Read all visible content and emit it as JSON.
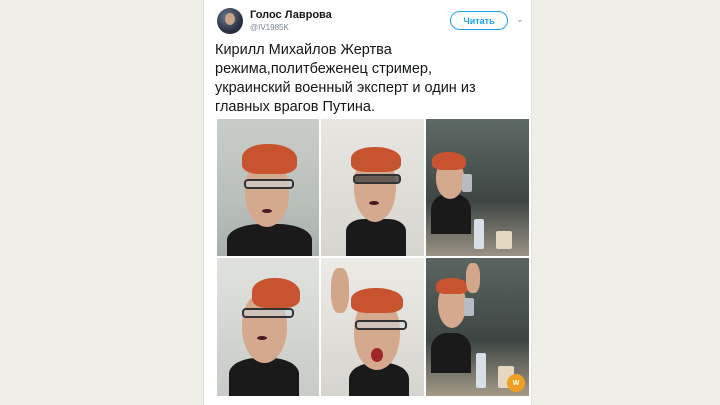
{
  "tweet": {
    "author_name": "Голос Лаврова",
    "author_handle": "@IV1985K",
    "follow_label": "Читать",
    "text_lines": [
      "Кирилл Михайлов  Жертва",
      "режима,политбеженец  стример,",
      "украинский военный эксперт и один из",
      "главных врагов Путина."
    ]
  },
  "photos": [
    {
      "alt": "selfie-1"
    },
    {
      "alt": "selfie-2"
    },
    {
      "alt": "selfie-3"
    },
    {
      "alt": "selfie-4"
    },
    {
      "alt": "selfie-5"
    },
    {
      "alt": "selfie-6"
    }
  ],
  "colors": {
    "accent": "#1da1f2",
    "background": "#efeee6",
    "hair": "#c8542f"
  },
  "icons": [
    "chevron-down-icon"
  ]
}
